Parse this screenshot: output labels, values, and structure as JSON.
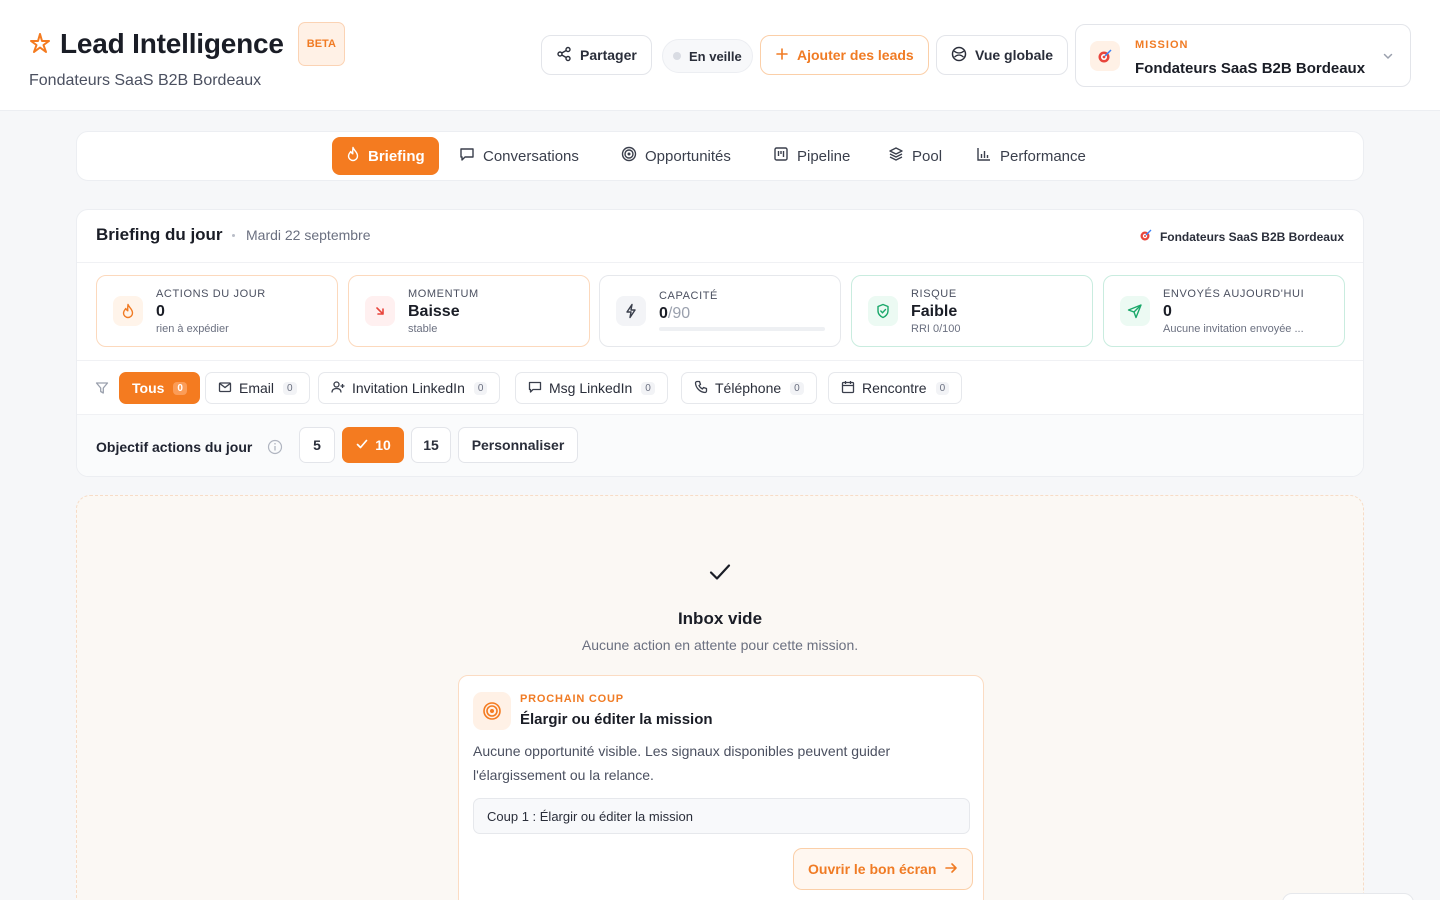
{
  "header": {
    "title": "Lead Intelligence",
    "beta": "BETA",
    "subtitle": "Fondateurs SaaS B2B Bordeaux",
    "share_label": "Partager",
    "standby_label": "En veille",
    "add_leads_label": "Ajouter des leads",
    "global_view_label": "Vue globale",
    "mission_label": "MISSION",
    "mission_name": "Fondateurs SaaS B2B Bordeaux",
    "accent": "#f47b20"
  },
  "tabs": [
    {
      "label": "Briefing",
      "icon": "flame-icon",
      "active": true
    },
    {
      "label": "Conversations",
      "icon": "chat-icon"
    },
    {
      "label": "Opportunités",
      "icon": "target-icon"
    },
    {
      "label": "Pipeline",
      "icon": "kanban-icon"
    },
    {
      "label": "Pool",
      "icon": "layers-icon"
    },
    {
      "label": "Performance",
      "icon": "bar-chart-icon"
    }
  ],
  "briefing": {
    "title": "Briefing du jour",
    "date": "Mardi 22 septembre",
    "mission": "Fondateurs SaaS B2B Bordeaux",
    "kpis": [
      {
        "label": "ACTIONS DU JOUR",
        "value": "0",
        "sub": "rien à expédier",
        "icon": "flame-icon"
      },
      {
        "label": "MOMENTUM",
        "value": "Baisse",
        "sub": "stable",
        "icon": "arrow-down-right-icon"
      },
      {
        "label": "CAPACITÉ",
        "value_main": "0",
        "value_rest": "/90",
        "fill": 0,
        "icon": "bolt-icon"
      },
      {
        "label": "RISQUE",
        "value": "Faible",
        "sub": "RRI 0/100",
        "icon": "shield-check-icon"
      },
      {
        "label": "ENVOYÉS AUJOURD'HUI",
        "value": "0",
        "sub": "Aucune invitation envoyée ...",
        "icon": "send-icon"
      }
    ],
    "filters": [
      {
        "label": "Tous",
        "count": "0",
        "active": true
      },
      {
        "label": "Email",
        "count": "0",
        "icon": "mail-icon"
      },
      {
        "label": "Invitation LinkedIn",
        "count": "0",
        "icon": "user-plus-icon"
      },
      {
        "label": "Msg LinkedIn",
        "count": "0",
        "icon": "chat-icon"
      },
      {
        "label": "Téléphone",
        "count": "0",
        "icon": "phone-icon"
      },
      {
        "label": "Rencontre",
        "count": "0",
        "icon": "calendar-icon"
      }
    ],
    "goal": {
      "label": "Objectif actions du jour",
      "options": [
        "5",
        "10",
        "15"
      ],
      "selected": "10",
      "custom_label": "Personnaliser"
    }
  },
  "empty": {
    "title": "Inbox vide",
    "subtitle": "Aucune action en attente pour cette mission.",
    "next": {
      "label": "PROCHAIN COUP",
      "title": "Élargir ou éditer la mission",
      "desc": "Aucune opportunité visible. Les signaux disponibles peuvent guider l'élargissement ou la relance.",
      "step": "Coup 1 : Élargir ou éditer la mission",
      "button": "Ouvrir le bon écran"
    }
  }
}
